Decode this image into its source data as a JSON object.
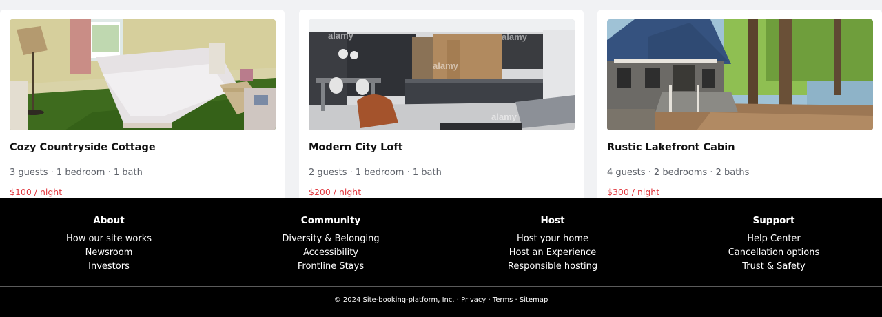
{
  "listings": [
    {
      "title": "Cozy Countryside Cottage",
      "details": "3 guests · 1 bedroom · 1 bath",
      "price": "$100 / night"
    },
    {
      "title": "Modern City Loft",
      "details": "2 guests · 1 bedroom · 1 bath",
      "price": "$200 / night",
      "photo_watermark": "alamy"
    },
    {
      "title": "Rustic Lakefront Cabin",
      "details": "4 guests · 2 bedrooms · 2 baths",
      "price": "$300 / night"
    }
  ],
  "footer": {
    "columns": [
      {
        "heading": "About",
        "links": [
          "How our site works",
          "Newsroom",
          "Investors"
        ]
      },
      {
        "heading": "Community",
        "links": [
          "Diversity & Belonging",
          "Accessibility",
          "Frontline Stays"
        ]
      },
      {
        "heading": "Host",
        "links": [
          "Host your home",
          "Host an Experience",
          "Responsible hosting"
        ]
      },
      {
        "heading": "Support",
        "links": [
          "Help Center",
          "Cancellation options",
          "Trust & Safety"
        ]
      }
    ],
    "copyright": "© 2024 Site-booking-platform, Inc.",
    "separator": " · ",
    "bottom_links": [
      "Privacy",
      "Terms",
      "Sitemap"
    ]
  },
  "colors": {
    "page_background": "#f1f2f4",
    "card_background": "#ffffff",
    "price": "#e0383f",
    "footer_background": "#000000",
    "footer_text": "#ffffff"
  }
}
